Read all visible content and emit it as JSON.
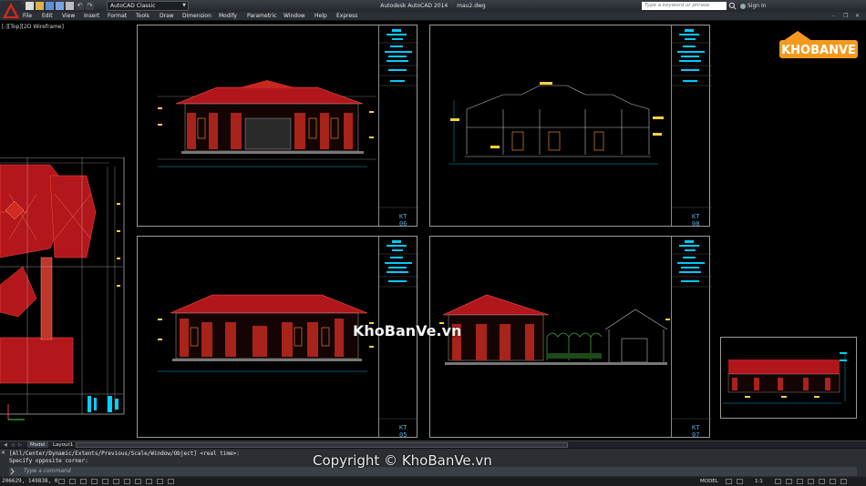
{
  "window": {
    "title": "Autodesk AutoCAD 2014",
    "filename": "mau2.dwg",
    "workspace": "AutoCAD Classic",
    "search_placeholder": "Type a keyword or phrase",
    "sign_in": "Sign In"
  },
  "menu": [
    "File",
    "Edit",
    "View",
    "Insert",
    "Format",
    "Tools",
    "Draw",
    "Dimension",
    "Modify",
    "Parametric",
    "Window",
    "Help",
    "Express"
  ],
  "viewport_label": "[-][Top][2D Wireframe]",
  "sheets": [
    {
      "id": "KT 06"
    },
    {
      "id": "KT 08"
    },
    {
      "id": "KT 05"
    },
    {
      "id": "KT 07"
    }
  ],
  "watermark": "KhoBanVe.vn",
  "brand_logo": "KHOBANVE",
  "tabs": [
    "Model",
    "Layout1"
  ],
  "command": {
    "history": [
      "[All/Center/Dynamic/Extents/Previous/Scale/Window/Object] <real time>:",
      "Specify opposite corner:"
    ],
    "placeholder": "Type a command"
  },
  "copyright": "Copyright © KhoBanVe.vn",
  "status": {
    "coords": "206629, 149838, 0",
    "model": "MODEL",
    "scale": "1:1"
  },
  "colors": {
    "roof": "#c0161a",
    "wall": "#a31a14",
    "cyan": "#00d8ff",
    "yellow": "#ffe600",
    "frame": "#9a9a9a",
    "brand_orange": "#f39a1e"
  }
}
